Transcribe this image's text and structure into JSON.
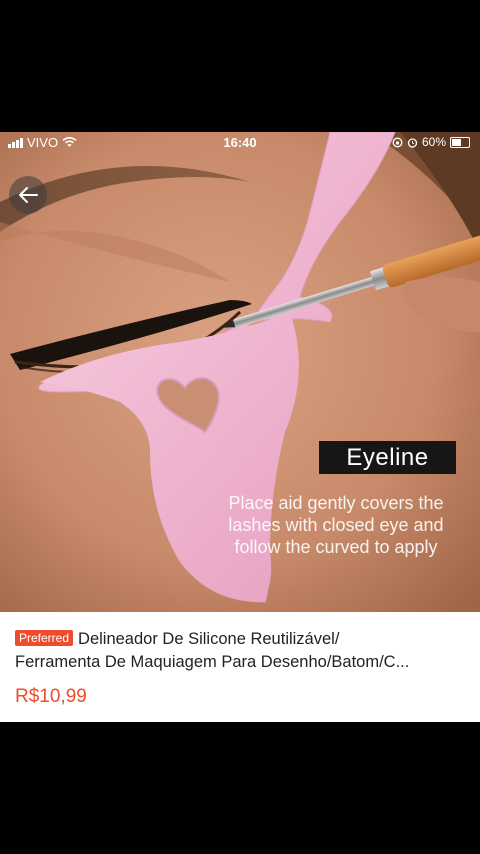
{
  "status_bar": {
    "carrier": "VIVO",
    "time": "16:40",
    "battery": "60%"
  },
  "photo": {
    "caption_title": "Eyeline",
    "caption_lines": [
      "Place aid gently covers the",
      "lashes with closed eye and",
      "follow the curved to apply"
    ]
  },
  "product": {
    "badge": "Preferred",
    "title_line1": "Delineador De Silicone Reutilizável/",
    "title_line2": "Ferramenta De Maquiagem Para Desenho/Batom/C...",
    "price": "R$10,99"
  },
  "colors": {
    "accent": "#ee4d2d",
    "stencil_pink": "#f2b6d2",
    "skin": "#c98c6c"
  },
  "icons": [
    "signal-icon",
    "wifi-icon",
    "lock-rotation-icon",
    "alarm-icon",
    "battery-icon",
    "back-arrow-icon"
  ]
}
